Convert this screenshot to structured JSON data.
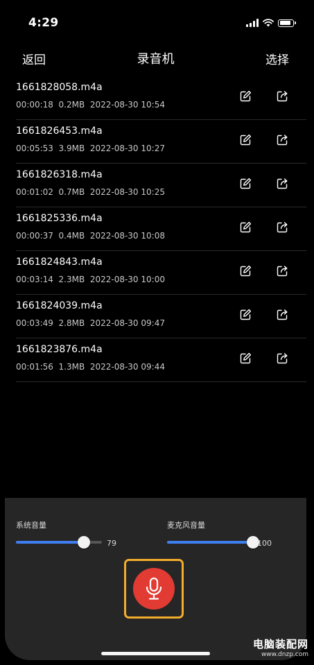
{
  "status_bar": {
    "time": "4:29"
  },
  "nav": {
    "back_label": "返回",
    "title": "录音机",
    "select_label": "选择"
  },
  "recordings": [
    {
      "name": "1661828058.m4a",
      "meta": "00:00:18  0.2MB  2022-08-30 10:54"
    },
    {
      "name": "1661826453.m4a",
      "meta": "00:05:53  3.9MB  2022-08-30 10:27"
    },
    {
      "name": "1661826318.m4a",
      "meta": "00:01:02  0.7MB  2022-08-30 10:25"
    },
    {
      "name": "1661825336.m4a",
      "meta": "00:00:37  0.4MB  2022-08-30 10:08"
    },
    {
      "name": "1661824843.m4a",
      "meta": "00:03:14  2.3MB  2022-08-30 10:00"
    },
    {
      "name": "1661824039.m4a",
      "meta": "00:03:49  2.8MB  2022-08-30 09:47"
    },
    {
      "name": "1661823876.m4a",
      "meta": "00:01:56  1.3MB  2022-08-30 09:44"
    }
  ],
  "row_icons": {
    "edit": "edit-icon",
    "share": "share-icon"
  },
  "controls": {
    "system_volume": {
      "label": "系统音量",
      "value": "79",
      "level": 0.79
    },
    "mic_volume": {
      "label": "麦克风音量",
      "value": "100",
      "level": 1.0
    },
    "record_icon": "microphone-icon"
  },
  "colors": {
    "record": "#e23b33",
    "record_highlight": "#f3ad2b",
    "slider_fill": "#3e7ef0",
    "panel_bg": "#262626"
  },
  "watermark": {
    "title": "电脑装配网",
    "url": "www.dnzp.com"
  }
}
